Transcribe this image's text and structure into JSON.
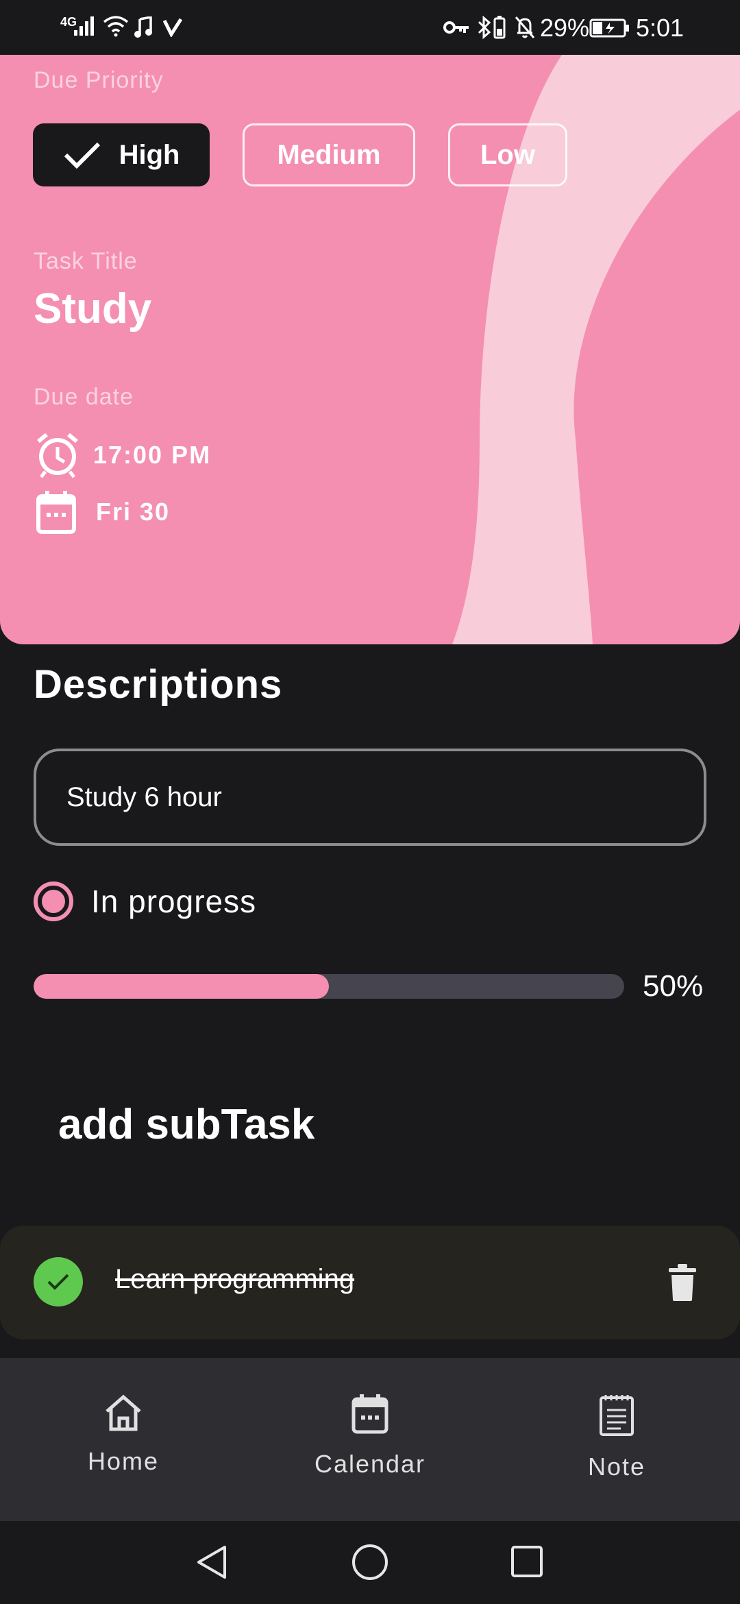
{
  "status_bar": {
    "network": "4G",
    "battery": "29%",
    "time": "5:01"
  },
  "header": {
    "priority_label": "Due Priority",
    "priorities": [
      {
        "label": "High",
        "selected": true
      },
      {
        "label": "Medium",
        "selected": false
      },
      {
        "label": "Low",
        "selected": false
      }
    ],
    "task_title_label": "Task Title",
    "task_title": "Study",
    "due_date_label": "Due date",
    "due_time": "17:00 PM",
    "due_day": "Fri 30",
    "background_color": "#f48fb1"
  },
  "descriptions": {
    "title": "Descriptions",
    "value": "Study 6 hour"
  },
  "status": {
    "label": "In progress",
    "progress_percent": 50,
    "progress_text": "50%"
  },
  "subtasks": {
    "add_label": "add subTask",
    "items": [
      {
        "label": "Learn programming",
        "done": true
      }
    ]
  },
  "bottom_nav": {
    "items": [
      {
        "label": "Home",
        "icon": "home-icon"
      },
      {
        "label": "Calendar",
        "icon": "calendar-icon"
      },
      {
        "label": "Note",
        "icon": "note-icon"
      }
    ]
  },
  "colors": {
    "accent": "#f48fb1",
    "background": "#19191c",
    "done_green": "#5fc84e"
  }
}
